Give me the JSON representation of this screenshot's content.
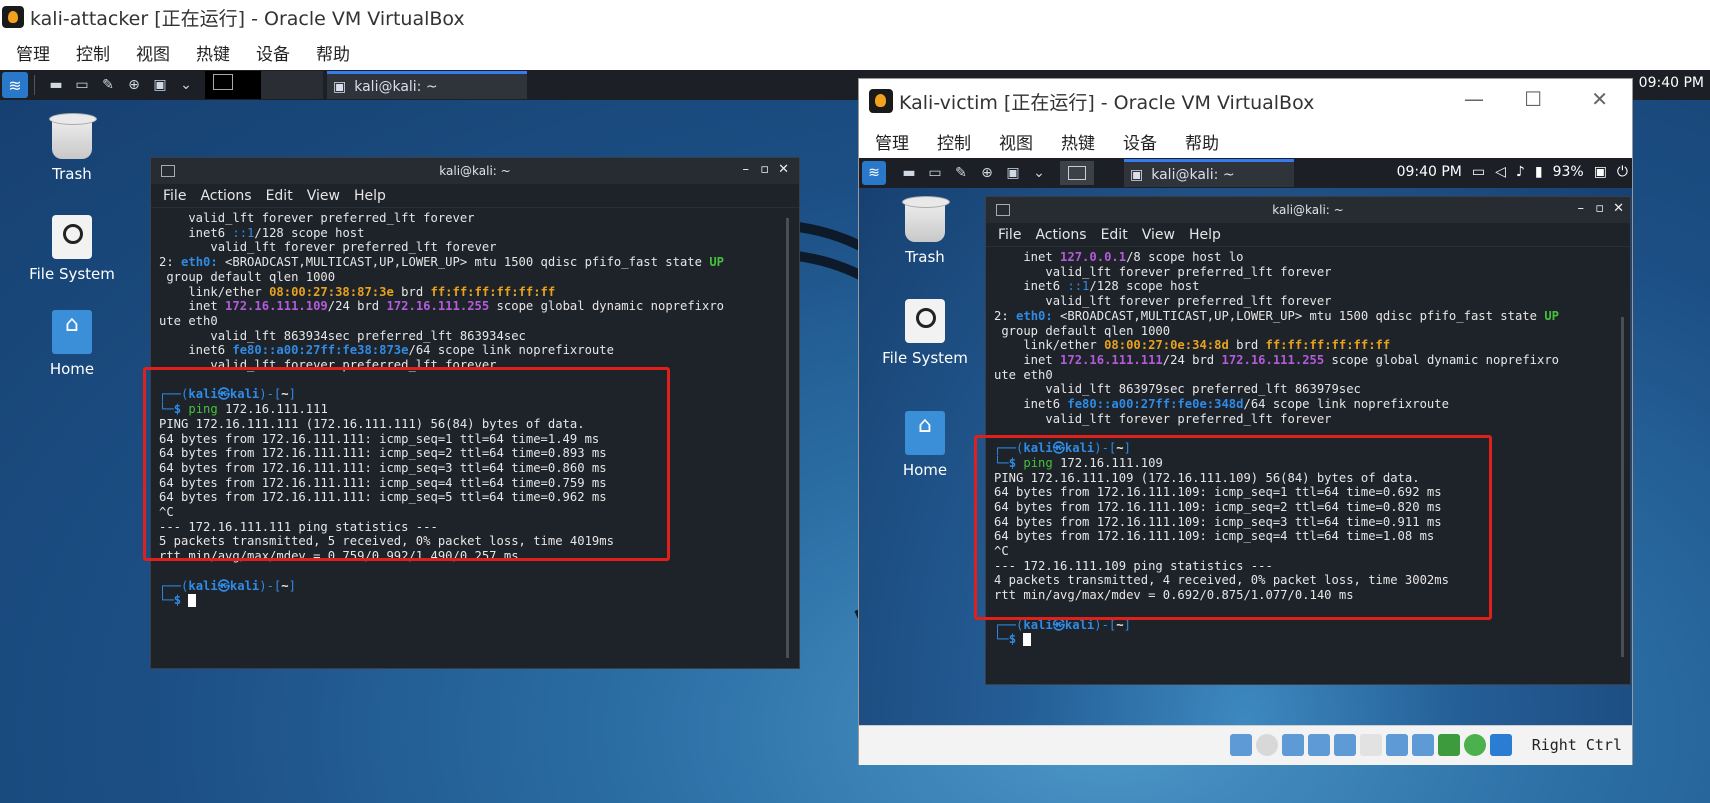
{
  "outer_window": {
    "title": "kali-attacker [正在运行] - Oracle VM VirtualBox",
    "menu": [
      "管理",
      "控制",
      "视图",
      "热键",
      "设备",
      "帮助"
    ]
  },
  "attacker_panel": {
    "task_label": "kali@kali: ~",
    "clock": "09:40 PM"
  },
  "desktop_icons": [
    {
      "label": "Trash",
      "icon": "trash-icon"
    },
    {
      "label": "File System",
      "icon": "drive-icon"
    },
    {
      "label": "Home",
      "icon": "home-folder-icon"
    }
  ],
  "attacker_terminal": {
    "title": "kali@kali: ~",
    "menu": [
      "File",
      "Actions",
      "Edit",
      "View",
      "Help"
    ],
    "lines": {
      "l1": "    valid_lft forever preferred_lft forever",
      "l2a": "    inet6 ",
      "l2b": "::1",
      "l2c": "/128 scope host",
      "l3": "       valid_lft forever preferred_lft forever",
      "l4a": "2: ",
      "l4b": "eth0:",
      "l4c": " <BROADCAST,MULTICAST,UP,LOWER_UP> mtu 1500 qdisc pfifo_fast state ",
      "l4d": "UP",
      "l5": " group default qlen 1000",
      "l6a": "    link/ether ",
      "l6b": "08:00:27:38:87:3e",
      "l6c": " brd ",
      "l6d": "ff:ff:ff:ff:ff:ff",
      "l7a": "    inet ",
      "l7b": "172.16.111.109",
      "l7c": "/24 brd ",
      "l7d": "172.16.111.255",
      "l7e": " scope global dynamic noprefixro",
      "l8": "ute eth0",
      "l9": "       valid_lft 863934sec preferred_lft 863934sec",
      "l10a": "    inet6 ",
      "l10b": "fe80::a00:27ff:fe38:873e",
      "l10c": "/64 scope link noprefixroute",
      "l11": "       valid_lft forever preferred_lft forever",
      "p1a": "┌──(",
      "p1b": "kali㉿kali",
      "p1c": ")-[",
      "p1d": "~",
      "p1e": "]",
      "p2a": "└─",
      "p2b": "$ ",
      "p2c": "ping",
      "p2d": " 172.16.111.111",
      "r1": "PING 172.16.111.111 (172.16.111.111) 56(84) bytes of data.",
      "r2": "64 bytes from 172.16.111.111: icmp_seq=1 ttl=64 time=1.49 ms",
      "r3": "64 bytes from 172.16.111.111: icmp_seq=2 ttl=64 time=0.893 ms",
      "r4": "64 bytes from 172.16.111.111: icmp_seq=3 ttl=64 time=0.860 ms",
      "r5": "64 bytes from 172.16.111.111: icmp_seq=4 ttl=64 time=0.759 ms",
      "r6": "64 bytes from 172.16.111.111: icmp_seq=5 ttl=64 time=0.962 ms",
      "r7": "^C",
      "r8": "--- 172.16.111.111 ping statistics ---",
      "r9": "5 packets transmitted, 5 received, 0% packet loss, time 4019ms",
      "r10": "rtt min/avg/max/mdev = 0.759/0.992/1.490/0.257 ms"
    }
  },
  "victim_window": {
    "title": "Kali-victim [正在运行] - Oracle VM VirtualBox",
    "menu": [
      "管理",
      "控制",
      "视图",
      "热键",
      "设备",
      "帮助"
    ],
    "panel_task": "kali@kali: ~",
    "clock": "09:40 PM",
    "battery": "93%",
    "host_key": "Right Ctrl"
  },
  "victim_terminal": {
    "title": "kali@kali: ~",
    "menu": [
      "File",
      "Actions",
      "Edit",
      "View",
      "Help"
    ],
    "lines": {
      "l1a": "    inet ",
      "l1b": "127.0.0.1",
      "l1c": "/8 scope host lo",
      "l2": "       valid_lft forever preferred_lft forever",
      "l3a": "    inet6 ",
      "l3b": "::1",
      "l3c": "/128 scope host",
      "l4": "       valid_lft forever preferred_lft forever",
      "l5a": "2: ",
      "l5b": "eth0:",
      "l5c": " <BROADCAST,MULTICAST,UP,LOWER_UP> mtu 1500 qdisc pfifo_fast state ",
      "l5d": "UP",
      "l6": " group default qlen 1000",
      "l7a": "    link/ether ",
      "l7b": "08:00:27:0e:34:8d",
      "l7c": " brd ",
      "l7d": "ff:ff:ff:ff:ff:ff",
      "l8a": "    inet ",
      "l8b": "172.16.111.111",
      "l8c": "/24 brd ",
      "l8d": "172.16.111.255",
      "l8e": " scope global dynamic noprefixro",
      "l9": "ute eth0",
      "l10": "       valid_lft 863979sec preferred_lft 863979sec",
      "l11a": "    inet6 ",
      "l11b": "fe80::a00:27ff:fe0e:348d",
      "l11c": "/64 scope link noprefixroute",
      "l12": "       valid_lft forever preferred_lft forever",
      "p1a": "┌──(",
      "p1b": "kali㉿kali",
      "p1c": ")-[",
      "p1d": "~",
      "p1e": "]",
      "p2a": "└─",
      "p2b": "$ ",
      "p2c": "ping",
      "p2d": " 172.16.111.109",
      "r1": "PING 172.16.111.109 (172.16.111.109) 56(84) bytes of data.",
      "r2": "64 bytes from 172.16.111.109: icmp_seq=1 ttl=64 time=0.692 ms",
      "r3": "64 bytes from 172.16.111.109: icmp_seq=2 ttl=64 time=0.820 ms",
      "r4": "64 bytes from 172.16.111.109: icmp_seq=3 ttl=64 time=0.911 ms",
      "r5": "64 bytes from 172.16.111.109: icmp_seq=4 ttl=64 time=1.08 ms",
      "r6": "^C",
      "r7": "--- 172.16.111.109 ping statistics ---",
      "r8": "4 packets transmitted, 4 received, 0% packet loss, time 3002ms",
      "r9": "rtt min/avg/max/mdev = 0.692/0.875/1.077/0.140 ms"
    }
  },
  "colors": {
    "highlight_box": "#e0201a",
    "prompt_blue": "#2f8ce6",
    "address_purple": "#b35bd9",
    "mac_orange": "#e8a21c",
    "state_green": "#45c13b"
  }
}
